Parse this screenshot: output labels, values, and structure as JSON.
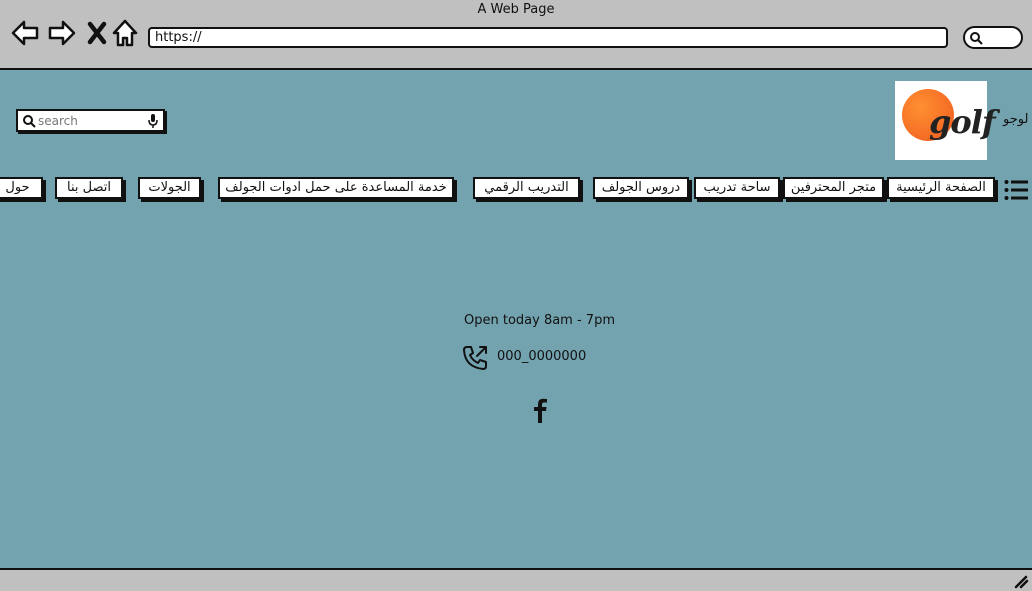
{
  "browser": {
    "title": "A Web Page",
    "url": "https://",
    "icons": [
      "back-arrow-icon",
      "forward-arrow-icon",
      "close-x-icon",
      "home-icon",
      "search-icon"
    ]
  },
  "header": {
    "search_placeholder": "search",
    "logo_label": "لوجو",
    "logo_text": "golf",
    "logo_color": "#ef5a20"
  },
  "nav": {
    "items": [
      {
        "label": "الصفحة الرئيسية"
      },
      {
        "label": "متجر المحترفين"
      },
      {
        "label": "ساحة تدريب"
      },
      {
        "label": "دروس الجولف"
      },
      {
        "label": "التدريب الرقمي"
      },
      {
        "label": "خدمة المساعدة على حمل ادوات الجولف"
      },
      {
        "label": "الجولات"
      },
      {
        "label": "اتصل بنا"
      },
      {
        "label": "حول"
      }
    ]
  },
  "content": {
    "hours": "Open today 8am - 7pm",
    "phone": "000_0000000"
  },
  "colors": {
    "page_background": "#74a3b0",
    "chrome": "#c0c0c0"
  }
}
